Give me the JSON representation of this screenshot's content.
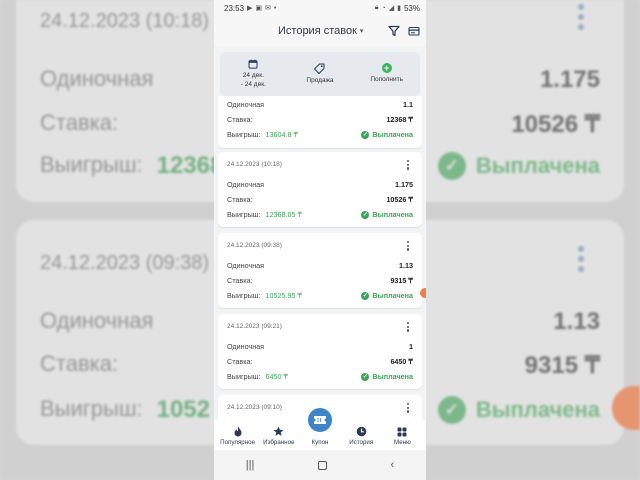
{
  "status": {
    "time": "23:53",
    "battery": "53%"
  },
  "header": {
    "title": "История ставок"
  },
  "toolbar": {
    "date_label": "24 дек.\n- 24 дек.",
    "date_line1": "24 дек.",
    "date_line2": "- 24 дек.",
    "sale_label": "Продажа",
    "topup_label": "Пополнить"
  },
  "labels": {
    "single": "Одиночная",
    "stake": "Ставка:",
    "win": "Выигрыш:",
    "paid": "Выплачена"
  },
  "bets": [
    {
      "date": "",
      "odds": "1.1",
      "stake": "12368 ₸",
      "win": "13604.8 ₸"
    },
    {
      "date": "24.12.2023 (10:18)",
      "odds": "1.175",
      "stake": "10526 ₸",
      "win": "12368.05 ₸"
    },
    {
      "date": "24.12.2023 (09:38)",
      "odds": "1.13",
      "stake": "9315 ₸",
      "win": "10525.95 ₸"
    },
    {
      "date": "24.12.2023 (09:21)",
      "odds": "1",
      "stake": "6450 ₸",
      "win": "6450 ₸"
    },
    {
      "date": "24.12.2023 (09:10)"
    }
  ],
  "background": {
    "card1": {
      "date": "24.12.2023 (10:18)",
      "type": "Одиночная",
      "odds": "1.175",
      "stake_label": "Ставка:",
      "stake": "10526 ₸",
      "win_label": "Выигрыш:",
      "win": "12368",
      "paid": "Выплачена"
    },
    "card2": {
      "date": "24.12.2023 (09:38)",
      "type": "Одиночная",
      "odds": "1.13",
      "stake_label": "Ставка:",
      "stake": "9315 ₸",
      "win_label": "Выигрыш:",
      "win": "1052",
      "paid": "Выплачена"
    }
  },
  "nav": {
    "popular": "Популярное",
    "favorites": "Избранное",
    "coupon": "Купон",
    "history": "История",
    "menu": "Меню"
  },
  "colors": {
    "accent_blue": "#3e85c6",
    "paid_green": "#3aa655",
    "nav_text": "#2b3a57"
  }
}
